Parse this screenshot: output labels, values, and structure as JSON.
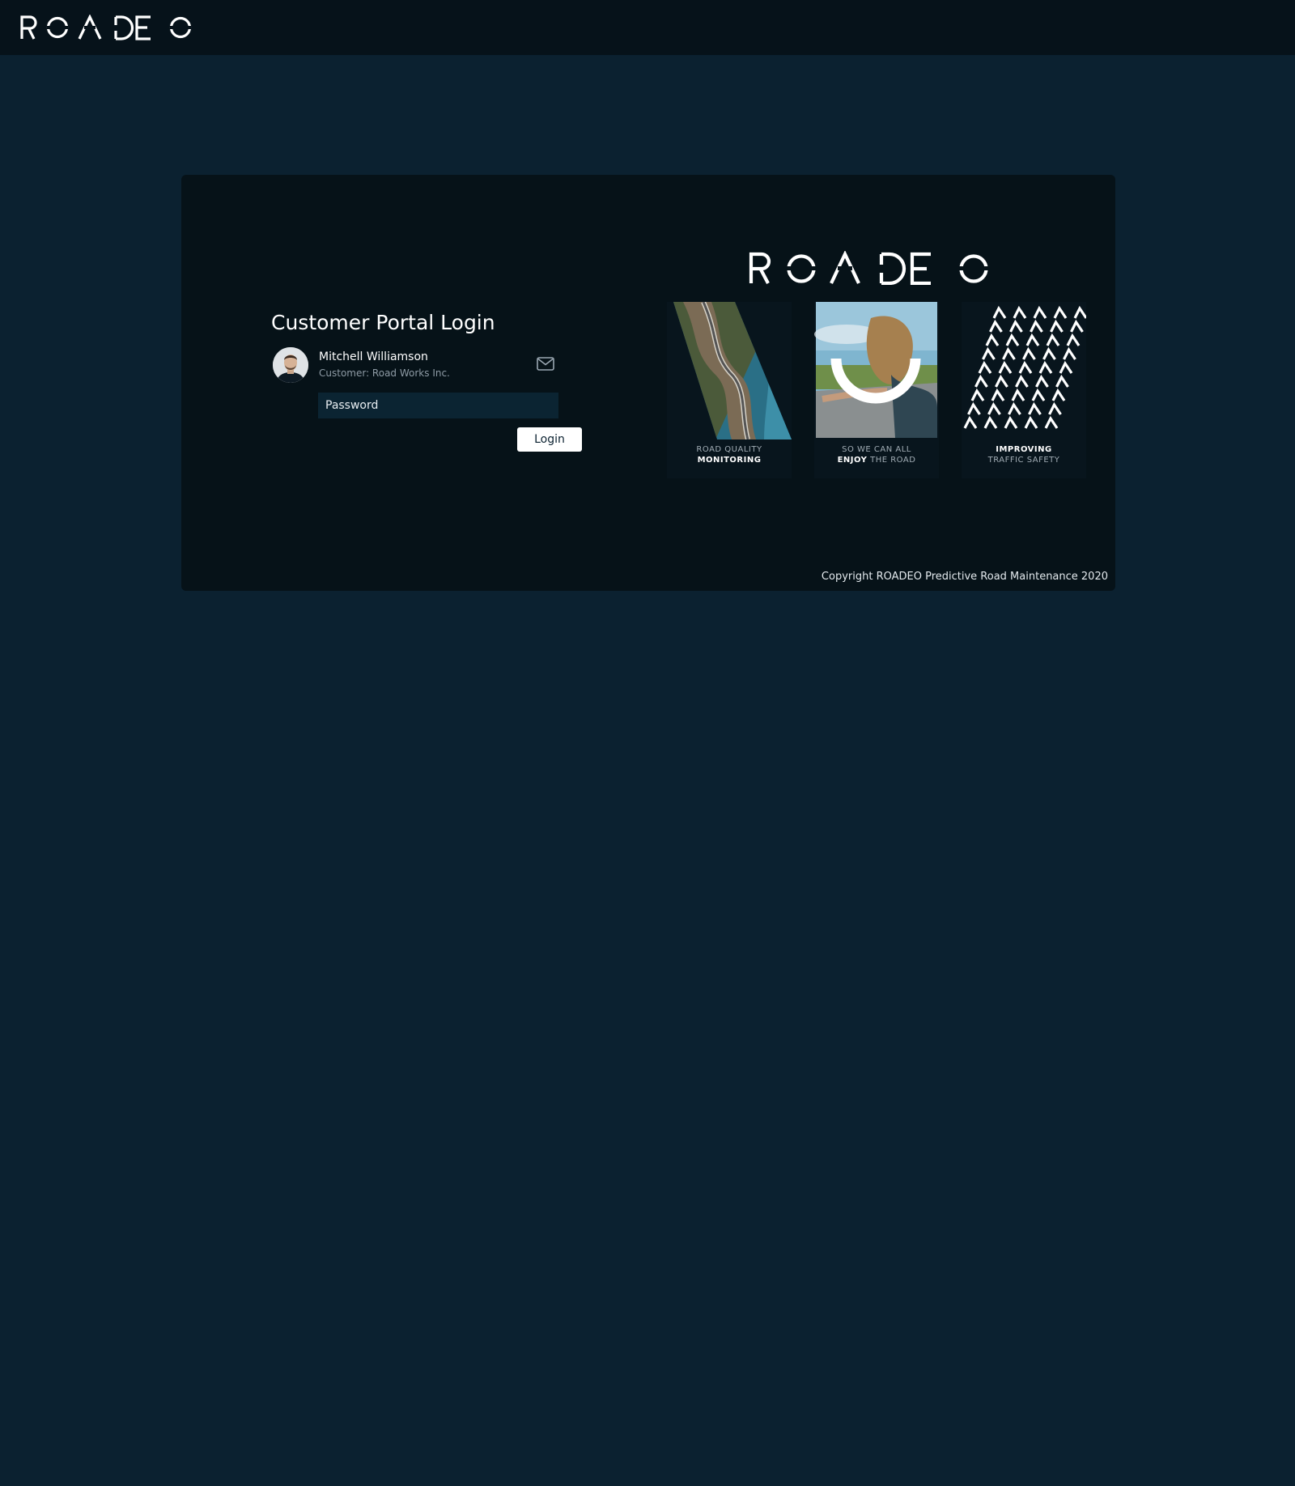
{
  "header": {
    "logo_text": "ROADEO"
  },
  "login": {
    "title": "Customer Portal Login",
    "user": {
      "name": "Mitchell Williamson",
      "organization": "Customer: Road Works Inc."
    },
    "password_placeholder": "Password",
    "login_label": "Login"
  },
  "brand": {
    "logo_text": "ROADEO",
    "cards": [
      {
        "line1": "ROAD QUALITY",
        "line2": "MONITORING",
        "image": "coastal-road-photo"
      },
      {
        "line1": "SO WE CAN ALL",
        "line2_strong": "ENJOY",
        "line2_rest": " THE ROAD",
        "image": "car-window-photo"
      },
      {
        "line1": "IMPROVING",
        "line2": "TRAFFIC SAFETY",
        "image": "chevron-pattern"
      }
    ]
  },
  "footer": {
    "copyright": "Copyright ROADEO Predictive Road Maintenance 2020"
  },
  "colors": {
    "page_background": "#0b2130",
    "topbar": "#06121a",
    "panel": "#061218",
    "input_background": "#0b2432",
    "button": "#ffffff"
  },
  "icons": [
    "mail-icon"
  ]
}
